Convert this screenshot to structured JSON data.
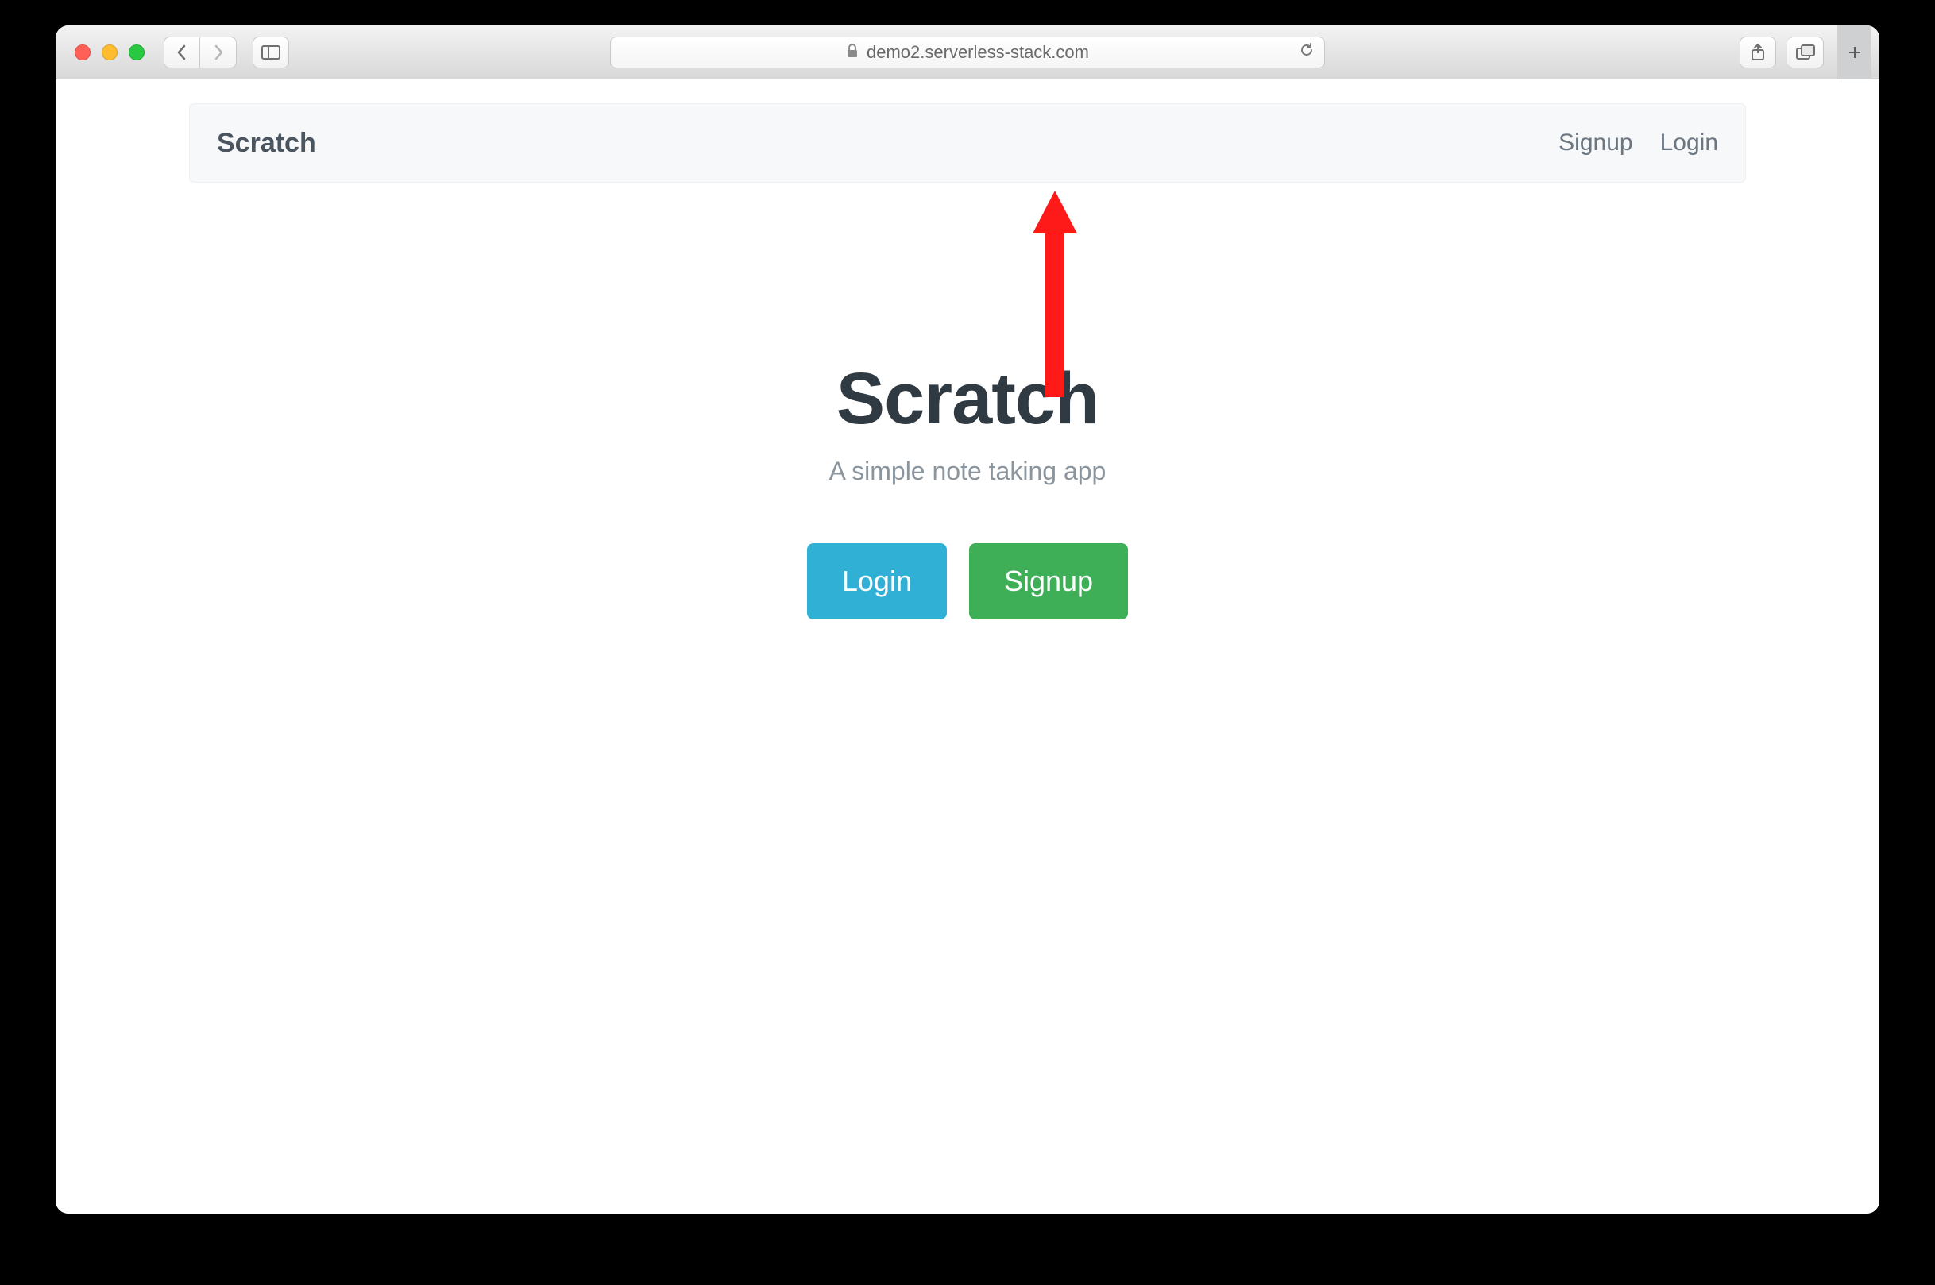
{
  "browser": {
    "url": "demo2.serverless-stack.com"
  },
  "navbar": {
    "brand": "Scratch",
    "links": {
      "signup": "Signup",
      "login": "Login"
    }
  },
  "hero": {
    "title": "Scratch",
    "subtitle": "A simple note taking app",
    "buttons": {
      "login": "Login",
      "signup": "Signup"
    }
  },
  "colors": {
    "info": "#31b0d5",
    "success": "#3eae57",
    "annotation": "#ff1a1a"
  }
}
